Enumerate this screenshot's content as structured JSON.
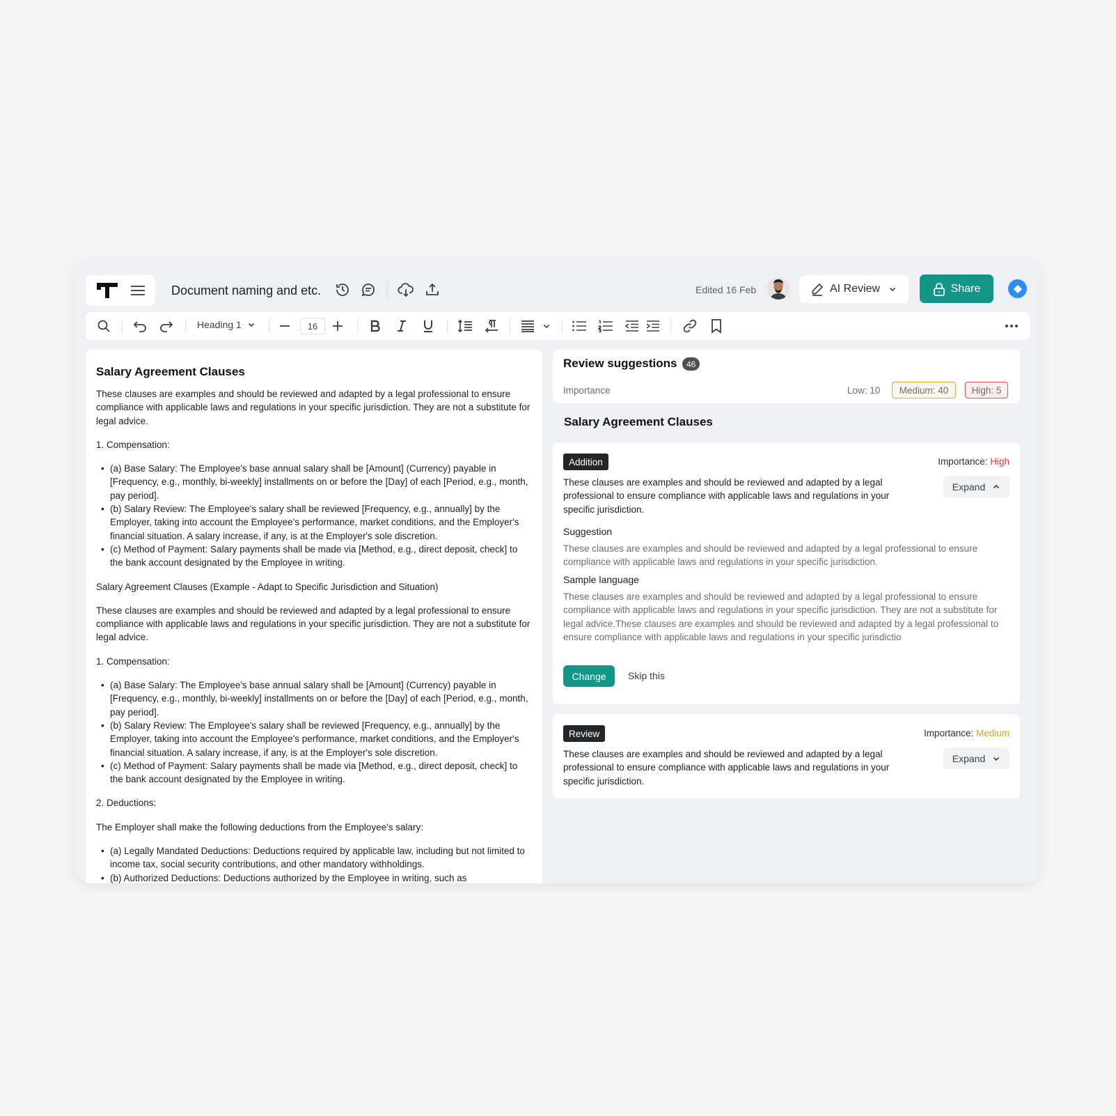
{
  "header": {
    "doc_title": "Document naming and etc.",
    "edited": "Edited 16 Feb",
    "ai_review_label": "AI Review",
    "share_label": "Share"
  },
  "toolbar": {
    "heading_style": "Heading 1",
    "font_size": "16"
  },
  "document": {
    "title": "Salary Agreement Clauses",
    "intro1": "These clauses are examples and should be reviewed and adapted by a legal professional to ensure compliance with applicable laws and regulations in your specific jurisdiction.  They are not a substitute for legal advice.",
    "comp1": "1. Compensation:",
    "list1": [
      "(a) Base Salary: The Employee's base annual salary shall be [Amount] (Currency) payable in [Frequency, e.g., monthly, bi-weekly] installments on or before the [Day] of each [Period, e.g., month, pay period].",
      "(b) Salary Review: The Employee's salary shall be reviewed [Frequency, e.g., annually] by the Employer, taking into account the Employee's performance, market conditions, and the Employer's financial situation.  A salary increase, if any, is at the Employer's sole discretion.",
      "(c) Method of Payment: Salary payments shall be made via [Method, e.g., direct deposit, check] to the bank account designated by the Employee in writing."
    ],
    "subtitle": "Salary Agreement Clauses (Example - Adapt to Specific Jurisdiction and Situation)",
    "intro2": "These clauses are examples and should be reviewed and adapted by a legal professional to ensure compliance with applicable laws and regulations in your specific jurisdiction.  They are not a substitute for legal advice.",
    "comp2": "1. Compensation:",
    "list2": [
      "(a) Base Salary: The Employee's base annual salary shall be [Amount] (Currency) payable in [Frequency, e.g., monthly, bi-weekly] installments on or before the [Day] of each [Period, e.g., month, pay period].",
      "(b) Salary Review: The Employee's salary shall be reviewed [Frequency, e.g., annually] by the Employer, taking into account the Employee's performance, market conditions, and the Employer's financial situation.  A salary increase, if any, is at the Employer's sole discretion.",
      "(c) Method of Payment: Salary payments shall be made via [Method, e.g., direct deposit, check] to the bank account designated by the Employee in writing."
    ],
    "deductions": "2. Deductions:",
    "deductions_intro": "The Employer shall make the following deductions from the Employee's salary:",
    "list3": [
      "(a) Legally Mandated Deductions: Deductions required by applicable law, including but not limited to income tax, social security contributions, and other mandatory withholdings.",
      "(b) Authorized Deductions: Deductions authorized by the Employee in writing, such as"
    ]
  },
  "review": {
    "title": "Review suggestions",
    "count": "46",
    "importance_label": "Importance",
    "low": "Low: 10",
    "medium": "Medium: 40",
    "high": "High: 5",
    "section_title": "Salary Agreement Clauses",
    "cards": [
      {
        "tag": "Addition",
        "importance_prefix": "Importance: ",
        "importance": "High",
        "body": "These clauses are examples and should be reviewed and adapted by a legal professional to ensure compliance with applicable laws and regulations in your specific jurisdiction.",
        "expand_label": "Expand",
        "suggestion_title": "Suggestion",
        "suggestion_text": "These clauses are examples and should be reviewed and adapted by a legal professional to ensure compliance with applicable laws and regulations in your specific jurisdiction.",
        "sample_title": "Sample language",
        "sample_text": "These clauses are examples and should be reviewed and adapted by a legal professional to ensure compliance with applicable laws and regulations in your specific jurisdiction.  They are not a substitute for legal advice.These clauses are examples and should be reviewed and adapted by a legal professional to ensure compliance with applicable laws and regulations in your specific jurisdictio",
        "change_label": "Change",
        "skip_label": "Skip this"
      },
      {
        "tag": "Review",
        "importance_prefix": "Importance: ",
        "importance": "Medium",
        "body": "These clauses are examples and should be reviewed and adapted by a legal professional to ensure compliance with applicable laws and regulations in your specific jurisdiction.",
        "expand_label": "Expand"
      }
    ]
  },
  "colors": {
    "accent": "#139688",
    "high": "#e33b3b",
    "medium": "#d9a031"
  }
}
